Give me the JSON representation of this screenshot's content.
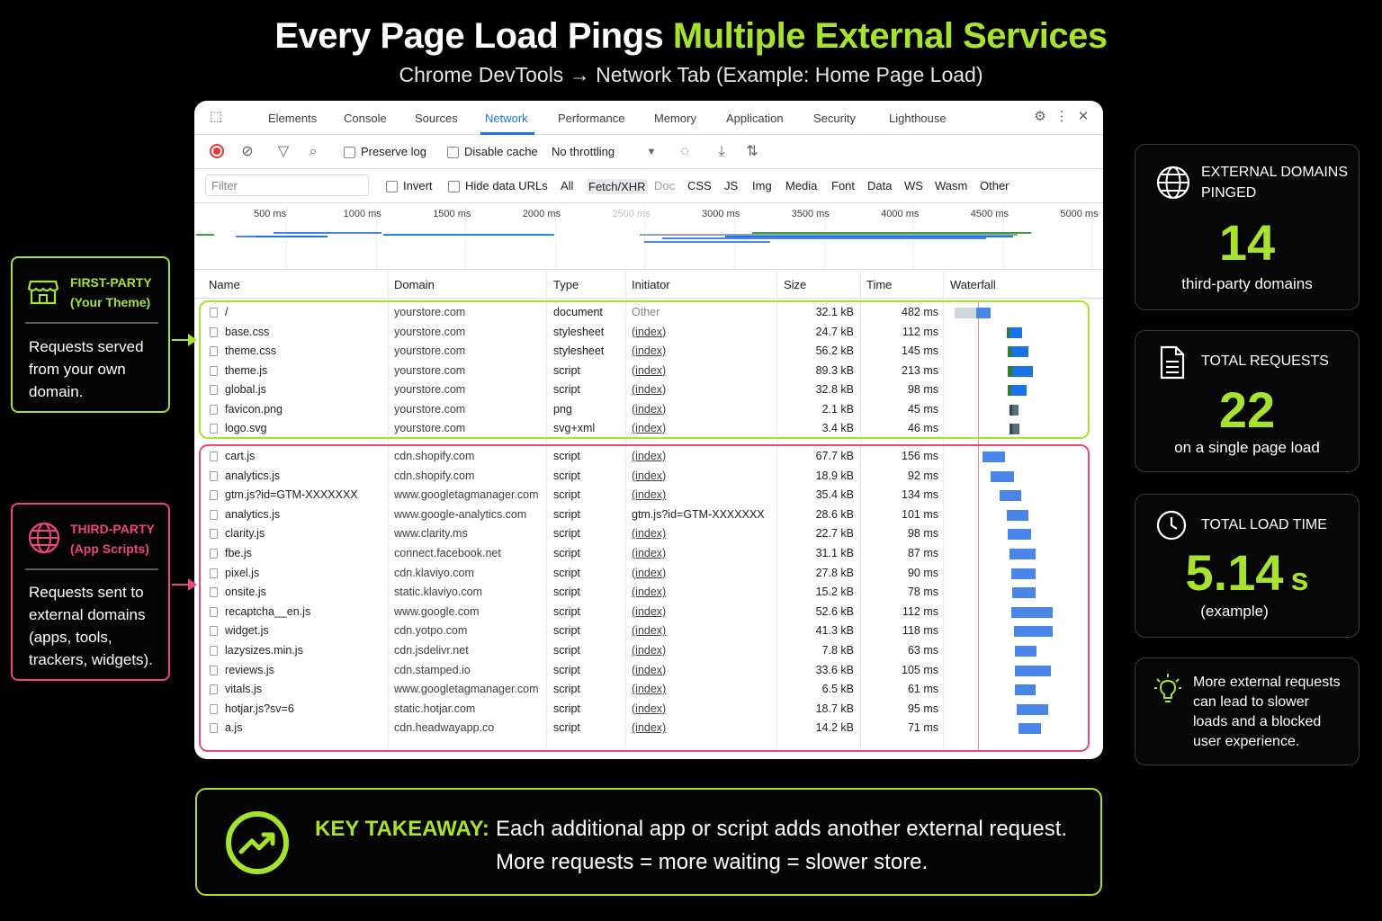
{
  "header": {
    "title_main": "Every Page Load Pings",
    "title_highlight": "Multiple External Services",
    "subtitle": "Chrome DevTools → Network Tab (Example: Home Page Load)"
  },
  "devtools": {
    "tabs": [
      "Elements",
      "Console",
      "Sources",
      "Network",
      "Performance",
      "Memory",
      "Application",
      "Security",
      "Lighthouse"
    ],
    "active_tab": "Network",
    "toolbar": {
      "preserve_log": "Preserve log",
      "disable_cache": "Disable cache",
      "throttling": "No throttling"
    },
    "filter": {
      "placeholder": "Filter",
      "invert": "Invert",
      "hide_data_urls": "Hide data URLs",
      "types": [
        "All",
        "Fetch/XHR",
        "Doc",
        "CSS",
        "JS",
        "Img",
        "Media",
        "Font",
        "Data",
        "WS",
        "Wasm",
        "Other"
      ]
    },
    "timeline_ticks": [
      "500 ms",
      "1000 ms",
      "1500 ms",
      "2000 ms",
      "2500 ms",
      "3000 ms",
      "3500 ms",
      "4000 ms",
      "4500 ms",
      "5000 ms"
    ],
    "columns": [
      "Name",
      "Domain",
      "Type",
      "Initiator",
      "Size",
      "Time",
      "Waterfall"
    ],
    "first_party_rows": [
      {
        "name": "/",
        "domain": "yourstore.com",
        "type": "document",
        "initiator": "Other",
        "size": "32.1 kB",
        "time": "482 ms",
        "wf_start": 0.02,
        "wf_len": 0.25
      },
      {
        "name": "base.css",
        "domain": "yourstore.com",
        "type": "stylesheet",
        "initiator": "(index)",
        "size": "24.7 kB",
        "time": "112 ms",
        "wf_start": 0.38,
        "wf_len": 0.11
      },
      {
        "name": "theme.css",
        "domain": "yourstore.com",
        "type": "stylesheet",
        "initiator": "(index)",
        "size": "56.2 kB",
        "time": "145 ms",
        "wf_start": 0.39,
        "wf_len": 0.14
      },
      {
        "name": "theme.js",
        "domain": "yourstore.com",
        "type": "script",
        "initiator": "(index)",
        "size": "89.3 kB",
        "time": "213 ms",
        "wf_start": 0.39,
        "wf_len": 0.17
      },
      {
        "name": "global.js",
        "domain": "yourstore.com",
        "type": "script",
        "initiator": "(index)",
        "size": "32.8 kB",
        "time": "98 ms",
        "wf_start": 0.39,
        "wf_len": 0.13
      },
      {
        "name": "favicon.png",
        "domain": "yourstore.com",
        "type": "png",
        "initiator": "(index)",
        "size": "2.1 kB",
        "time": "45 ms",
        "wf_start": 0.4,
        "wf_len": 0.06
      },
      {
        "name": "logo.svg",
        "domain": "yourstore.com",
        "type": "svg+xml",
        "initiator": "(index)",
        "size": "3.4 kB",
        "time": "46 ms",
        "wf_start": 0.4,
        "wf_len": 0.07
      }
    ],
    "third_party_rows": [
      {
        "name": "cart.js",
        "domain": "cdn.shopify.com",
        "type": "script",
        "initiator": "(index)",
        "size": "67.7 kB",
        "time": "156 ms",
        "wf_start": 0.21,
        "wf_len": 0.16
      },
      {
        "name": "analytics.js",
        "domain": "cdn.shopify.com",
        "type": "script",
        "initiator": "(index)",
        "size": "18.9 kB",
        "time": "92 ms",
        "wf_start": 0.27,
        "wf_len": 0.16
      },
      {
        "name": "gtm.js?id=GTM-XXXXXXX",
        "domain": "www.googletagmanager.com",
        "type": "script",
        "initiator": "(index)",
        "size": "35.4 kB",
        "time": "134 ms",
        "wf_start": 0.33,
        "wf_len": 0.15
      },
      {
        "name": "analytics.js",
        "domain": "www.google-analytics.com",
        "type": "script",
        "initiator": "gtm.js?id=GTM-XXXXXXX",
        "size": "28.6 kB",
        "time": "101 ms",
        "wf_start": 0.38,
        "wf_len": 0.15
      },
      {
        "name": "clarity.js",
        "domain": "www.clarity.ms",
        "type": "script",
        "initiator": "(index)",
        "size": "22.7 kB",
        "time": "98 ms",
        "wf_start": 0.39,
        "wf_len": 0.16
      },
      {
        "name": "fbe.js",
        "domain": "connect.facebook.net",
        "type": "script",
        "initiator": "(index)",
        "size": "31.1 kB",
        "time": "87 ms",
        "wf_start": 0.4,
        "wf_len": 0.18
      },
      {
        "name": "pixel.js",
        "domain": "cdn.klaviyo.com",
        "type": "script",
        "initiator": "(index)",
        "size": "27.8 kB",
        "time": "90 ms",
        "wf_start": 0.41,
        "wf_len": 0.17
      },
      {
        "name": "onsite.js",
        "domain": "static.klaviyo.com",
        "type": "script",
        "initiator": "(index)",
        "size": "15.2 kB",
        "time": "78 ms",
        "wf_start": 0.42,
        "wf_len": 0.16
      },
      {
        "name": "recaptcha__en.js",
        "domain": "www.google.com",
        "type": "script",
        "initiator": "(index)",
        "size": "52.6 kB",
        "time": "112 ms",
        "wf_start": 0.41,
        "wf_len": 0.29
      },
      {
        "name": "widget.js",
        "domain": "cdn.yotpo.com",
        "type": "script",
        "initiator": "(index)",
        "size": "41.3 kB",
        "time": "118 ms",
        "wf_start": 0.43,
        "wf_len": 0.27
      },
      {
        "name": "lazysizes.min.js",
        "domain": "cdn.jsdelivr.net",
        "type": "script",
        "initiator": "(index)",
        "size": "7.8 kB",
        "time": "63 ms",
        "wf_start": 0.44,
        "wf_len": 0.15
      },
      {
        "name": "reviews.js",
        "domain": "cdn.stamped.io",
        "type": "script",
        "initiator": "(index)",
        "size": "33.6 kB",
        "time": "105 ms",
        "wf_start": 0.44,
        "wf_len": 0.25
      },
      {
        "name": "vitals.js",
        "domain": "www.googletagmanager.com",
        "type": "script",
        "initiator": "(index)",
        "size": "6.5 kB",
        "time": "61 ms",
        "wf_start": 0.44,
        "wf_len": 0.14
      },
      {
        "name": "hotjar.js?sv=6",
        "domain": "static.hotjar.com",
        "type": "script",
        "initiator": "(index)",
        "size": "18.7 kB",
        "time": "95 ms",
        "wf_start": 0.45,
        "wf_len": 0.22
      },
      {
        "name": "a.js",
        "domain": "cdn.headwayapp.co",
        "type": "script",
        "initiator": "(index)",
        "size": "14.2 kB",
        "time": "71 ms",
        "wf_start": 0.46,
        "wf_len": 0.16
      }
    ]
  },
  "callouts": {
    "first_party": {
      "title_line1": "FIRST-PARTY",
      "title_line2": "(Your Theme)",
      "body": [
        "Requests served",
        "from your own",
        "domain."
      ],
      "color": "#a6e22e"
    },
    "third_party": {
      "title_line1": "THIRD-PARTY",
      "title_line2": "(App Scripts)",
      "body": [
        "Requests sent to",
        "external domains",
        "(apps, tools,",
        "trackers, widgets)."
      ],
      "color": "#f0457a"
    }
  },
  "stats": {
    "domains": {
      "label_line1": "EXTERNAL DOMAINS",
      "label_line2": "PINGED",
      "value": "14",
      "sub": "third-party domains"
    },
    "requests": {
      "label": "TOTAL REQUESTS",
      "value": "22",
      "sub": "on a single page load"
    },
    "load_time": {
      "label": "TOTAL LOAD TIME",
      "value": "5.14",
      "unit": "s",
      "sub": "(example)"
    },
    "note": [
      "More external requests",
      "can lead to slower",
      "loads and a blocked",
      "user experience."
    ]
  },
  "takeaway": {
    "label": "KEY TAKEAWAY:",
    "line1": "Each additional app or script adds another external request.",
    "line2": "More requests = more waiting = slower store."
  },
  "colors": {
    "accent_green": "#a6e22e",
    "accent_pink": "#f0457a",
    "devtools_blue": "#1a73e8",
    "waterfall_blue": "#4a86e8"
  }
}
